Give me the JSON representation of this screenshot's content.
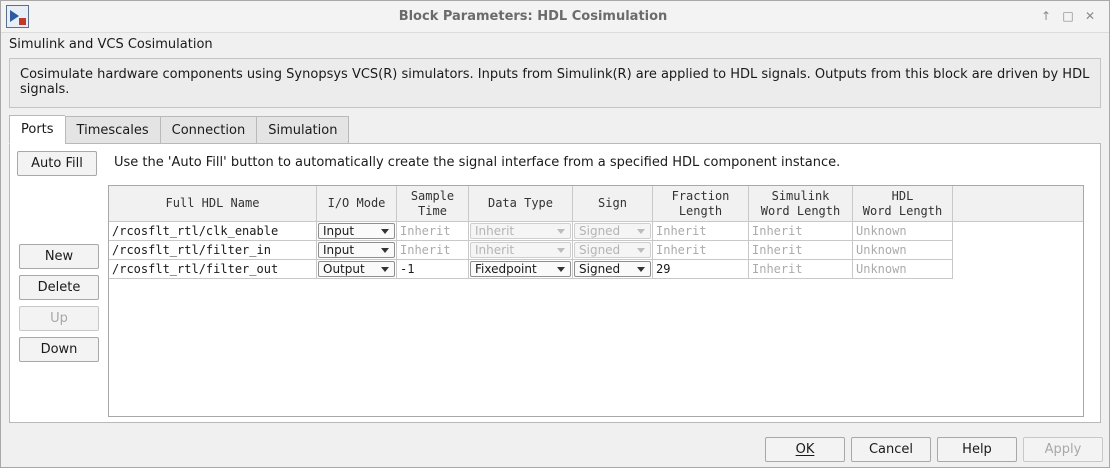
{
  "window": {
    "title": "Block Parameters: HDL Cosimulation",
    "controls": [
      "↑",
      "□",
      "✕"
    ]
  },
  "header": {
    "subtitle": "Simulink and VCS Cosimulation",
    "description": "Cosimulate hardware components using Synopsys VCS(R) simulators.  Inputs from Simulink(R) are applied to HDL signals.  Outputs from this block are driven by HDL signals."
  },
  "tabs": [
    {
      "label": "Ports",
      "active": true
    },
    {
      "label": "Timescales",
      "active": false
    },
    {
      "label": "Connection",
      "active": false
    },
    {
      "label": "Simulation",
      "active": false
    }
  ],
  "ports": {
    "autofill_label": "Auto Fill",
    "autofill_hint": "Use the 'Auto Fill' button to automatically create the signal interface from a specified HDL component instance.",
    "buttons": {
      "new": "New",
      "delete": "Delete",
      "up": "Up",
      "down": "Down"
    },
    "columns": [
      "Full HDL Name",
      "I/O Mode",
      "Sample\nTime",
      "Data Type",
      "Sign",
      "Fraction\nLength",
      "Simulink\nWord Length",
      "HDL\nWord Length"
    ],
    "rows": [
      {
        "name": "/rcosflt_rtl/clk_enable",
        "io_mode": "Input",
        "sample_time": "Inherit",
        "data_type": "Inherit",
        "sign": "Signed",
        "fraction_length": "Inherit",
        "simulink_word_length": "Inherit",
        "hdl_word_length": "Unknown"
      },
      {
        "name": "/rcosflt_rtl/filter_in",
        "io_mode": "Input",
        "sample_time": "Inherit",
        "data_type": "Inherit",
        "sign": "Signed",
        "fraction_length": "Inherit",
        "simulink_word_length": "Inherit",
        "hdl_word_length": "Unknown"
      },
      {
        "name": "/rcosflt_rtl/filter_out",
        "io_mode": "Output",
        "sample_time": "-1",
        "data_type": "Fixedpoint",
        "sign": "Signed",
        "fraction_length": "29",
        "simulink_word_length": "Inherit",
        "hdl_word_length": "Unknown"
      }
    ]
  },
  "footer": {
    "ok": "OK",
    "cancel": "Cancel",
    "help": "Help",
    "apply": "Apply"
  },
  "colors": {
    "window_bg": "#f0f0f0",
    "panel_bg": "#ffffff",
    "border": "#b9b9b9",
    "disabled_text": "#ababab"
  }
}
